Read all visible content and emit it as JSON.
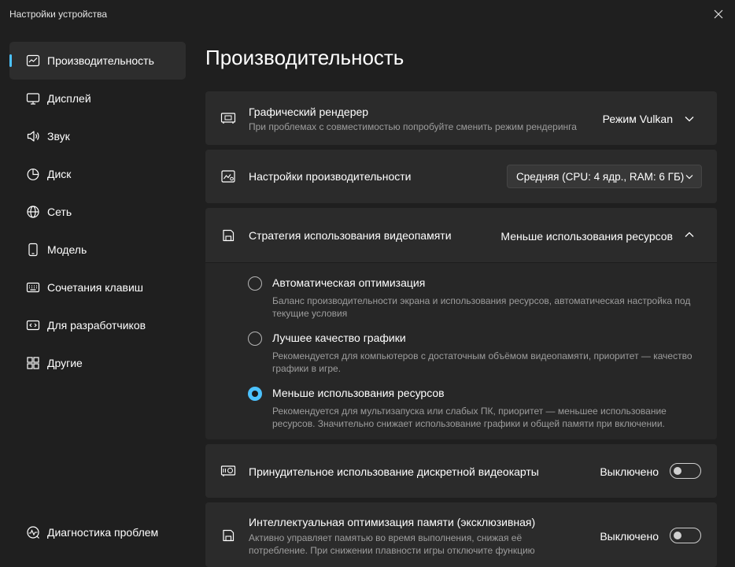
{
  "window": {
    "title": "Настройки устройства"
  },
  "sidebar": {
    "items": [
      {
        "label": "Производительность",
        "icon": "performance-chart-icon",
        "active": true
      },
      {
        "label": "Дисплей",
        "icon": "monitor-icon"
      },
      {
        "label": "Звук",
        "icon": "speaker-icon"
      },
      {
        "label": "Диск",
        "icon": "pie-chart-icon"
      },
      {
        "label": "Сеть",
        "icon": "globe-icon"
      },
      {
        "label": "Модель",
        "icon": "phone-icon"
      },
      {
        "label": "Сочетания клавиш",
        "icon": "keyboard-icon"
      },
      {
        "label": "Для разработчиков",
        "icon": "code-icon"
      },
      {
        "label": "Другие",
        "icon": "grid-icon"
      }
    ],
    "bottom_item": {
      "label": "Диагностика проблем",
      "icon": "diagnostics-icon"
    }
  },
  "main": {
    "page_title": "Производительность",
    "renderer": {
      "title": "Графический рендерер",
      "subtitle": "При проблемах с совместимостью попробуйте сменить режим рендеринга",
      "value": "Режим Vulkan"
    },
    "performance": {
      "title": "Настройки производительности",
      "value": "Средняя (CPU: 4 ядр., RAM: 6 ГБ)"
    },
    "vram": {
      "title": "Стратегия использования видеопамяти",
      "value": "Меньше использования ресурсов",
      "options": [
        {
          "title": "Автоматическая оптимизация",
          "desc": "Баланс производительности экрана и использования ресурсов, автоматическая настройка под текущие условия",
          "selected": false
        },
        {
          "title": "Лучшее качество графики",
          "desc": "Рекомендуется для компьютеров с достаточным объёмом видеопамяти, приоритет — качество графики в игре.",
          "selected": false
        },
        {
          "title": "Меньше использования ресурсов",
          "desc": "Рекомендуется для мультизапуска или слабых ПК, приоритет — меньшее использование ресурсов. Значительно снижает использование графики и общей памяти при включении.",
          "selected": true
        }
      ]
    },
    "discrete_gpu": {
      "title": "Принудительное использование дискретной видеокарты",
      "state_label": "Выключено",
      "on": false
    },
    "smart_memory": {
      "title": "Интеллектуальная оптимизация памяти (эксклюзивная)",
      "subtitle": "Активно управляет памятью во время выполнения, снижая её потребление. При снижении плавности игры отключите функцию",
      "state_label": "Выключено",
      "on": false
    }
  },
  "colors": {
    "accent": "#4cc2ff",
    "background": "#1f1f1f",
    "card": "#2b2b2b"
  }
}
